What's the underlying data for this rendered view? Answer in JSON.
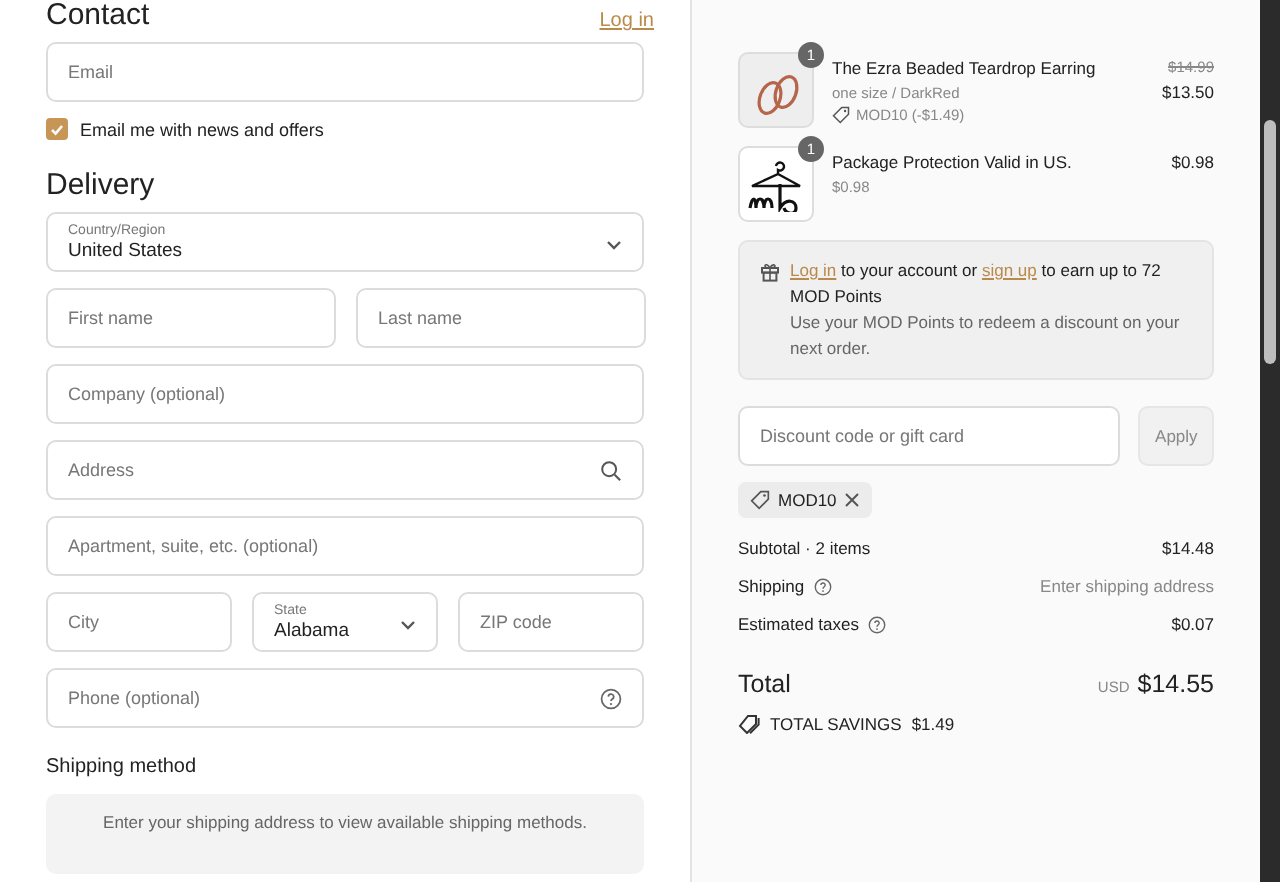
{
  "contact": {
    "title": "Contact",
    "login_link": "Log in",
    "email": {
      "placeholder": "Email"
    },
    "newsletter": {
      "label": "Email me with news and offers",
      "checked": true
    }
  },
  "delivery": {
    "title": "Delivery",
    "rows": [
      [
        {
          "kind": "select",
          "label": "Country/Region",
          "value": "United States"
        }
      ],
      [
        {
          "kind": "text",
          "placeholder": "First name"
        },
        {
          "kind": "text",
          "placeholder": "Last name"
        }
      ],
      [
        {
          "kind": "text",
          "placeholder": "Company (optional)"
        }
      ],
      [
        {
          "kind": "search",
          "placeholder": "Address"
        }
      ],
      [
        {
          "kind": "text",
          "placeholder": "Apartment, suite, etc. (optional)"
        }
      ],
      [
        {
          "kind": "text",
          "placeholder": "City"
        },
        {
          "kind": "select",
          "label": "State",
          "value": "Alabama"
        },
        {
          "kind": "text",
          "placeholder": "ZIP code"
        }
      ],
      [
        {
          "kind": "help",
          "placeholder": "Phone (optional)"
        }
      ]
    ]
  },
  "shipping_method": {
    "title": "Shipping method",
    "notice": "Enter your shipping address to view available shipping methods."
  },
  "order": {
    "items": [
      {
        "kind": "earring",
        "quantity": "1",
        "name": "The Ezra Beaded Teardrop Earring",
        "variant": "one size / DarkRed",
        "discount": "MOD10 (-$1.49)",
        "original_price": "$14.99",
        "price": "$13.50"
      },
      {
        "kind": "logo",
        "quantity": "1",
        "name": "Package Protection Valid in US.",
        "variant": "$0.98",
        "price": "$0.98"
      }
    ],
    "points": {
      "login": "Log in",
      "middle": "to your account or",
      "signup": "sign up",
      "rest": "to earn up to 72 MOD Points",
      "note": "Use your MOD Points to redeem a discount on your next order."
    },
    "discount": {
      "placeholder": "Discount code or gift card",
      "button": "Apply",
      "applied_code": "MOD10"
    },
    "summary": [
      {
        "label": "Subtotal · 2 items",
        "value": "$14.48",
        "help": false,
        "muted": false
      },
      {
        "label": "Shipping",
        "value": "Enter shipping address",
        "help": true,
        "muted": true
      },
      {
        "label": "Estimated taxes",
        "value": "$0.07",
        "help": true,
        "muted": false
      }
    ],
    "total": {
      "label": "Total",
      "currency": "USD",
      "value": "$14.55"
    },
    "savings": {
      "label": "TOTAL SAVINGS",
      "value": "$1.49"
    }
  }
}
